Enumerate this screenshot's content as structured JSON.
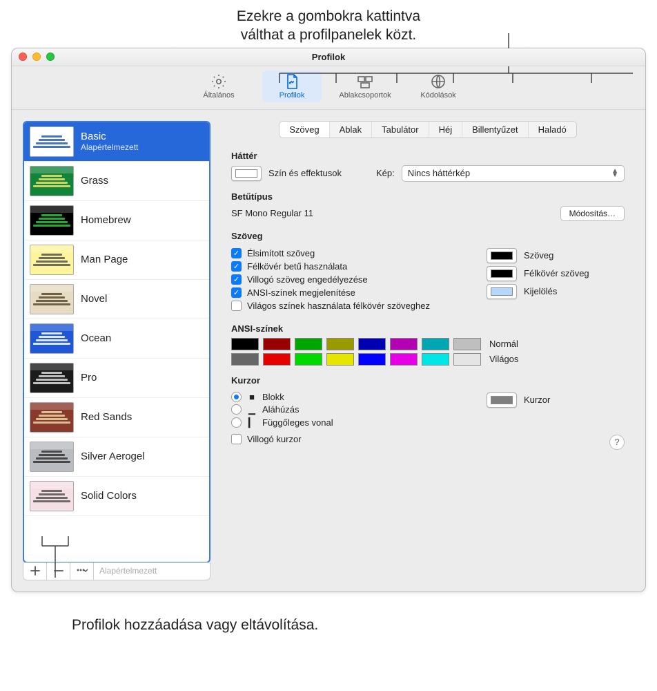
{
  "callouts": {
    "top_line1": "Ezekre a gombokra kattintva",
    "top_line2": "válthat a profilpanelek közt.",
    "bottom": "Profilok hozzáadása vagy eltávolítása."
  },
  "window": {
    "title": "Profilok"
  },
  "toolbar": {
    "items": [
      {
        "label": "Általános"
      },
      {
        "label": "Profilok"
      },
      {
        "label": "Ablakcsoportok"
      },
      {
        "label": "Kódolások"
      }
    ]
  },
  "sidebar": {
    "profiles": [
      {
        "name": "Basic",
        "subtitle": "Alapértelmezett",
        "bg": "#ffffff",
        "fg": "#2a5db0"
      },
      {
        "name": "Grass",
        "subtitle": "",
        "bg": "#12853a",
        "fg": "#f0e26a"
      },
      {
        "name": "Homebrew",
        "subtitle": "",
        "bg": "#000000",
        "fg": "#27c93f"
      },
      {
        "name": "Man Page",
        "subtitle": "",
        "bg": "#fdf49b",
        "fg": "#555555"
      },
      {
        "name": "Novel",
        "subtitle": "",
        "bg": "#e6dcc3",
        "fg": "#5a4b2f"
      },
      {
        "name": "Ocean",
        "subtitle": "",
        "bg": "#1f57d6",
        "fg": "#ffffff"
      },
      {
        "name": "Pro",
        "subtitle": "",
        "bg": "#1b1b1b",
        "fg": "#dddddd"
      },
      {
        "name": "Red Sands",
        "subtitle": "",
        "bg": "#8a3a2d",
        "fg": "#e8d7a6"
      },
      {
        "name": "Silver Aerogel",
        "subtitle": "",
        "bg": "#b9bcc0",
        "fg": "#333333"
      },
      {
        "name": "Solid Colors",
        "subtitle": "",
        "bg": "#f6dfe4",
        "fg": "#555555"
      }
    ],
    "footer_default": "Alapértelmezett"
  },
  "tabs": [
    "Szöveg",
    "Ablak",
    "Tabulátor",
    "Héj",
    "Billentyűzet",
    "Haladó"
  ],
  "panel": {
    "background": {
      "title": "Háttér",
      "swatch_label": "Szín és effektusok",
      "image_label": "Kép:",
      "image_select": "Nincs háttérkép"
    },
    "font": {
      "title": "Betűtípus",
      "value": "SF Mono Regular 11",
      "change_btn": "Módosítás…"
    },
    "text": {
      "title": "Szöveg",
      "checks": [
        {
          "label": "Élsimított szöveg",
          "on": true
        },
        {
          "label": "Félkövér betű használata",
          "on": true
        },
        {
          "label": "Villogó szöveg engedélyezése",
          "on": true
        },
        {
          "label": "ANSI-színek megjelenítése",
          "on": true
        },
        {
          "label": "Világos színek használata félkövér szöveghez",
          "on": false
        }
      ],
      "swatches": [
        {
          "label": "Szöveg",
          "color": "#000000"
        },
        {
          "label": "Félkövér szöveg",
          "color": "#000000"
        },
        {
          "label": "Kijelölés",
          "color": "#b3d7ff"
        }
      ]
    },
    "ansi": {
      "title": "ANSI-színek",
      "normal_label": "Normál",
      "bright_label": "Világos",
      "normal": [
        "#000000",
        "#990000",
        "#00a600",
        "#999900",
        "#0000b2",
        "#b200b2",
        "#00a6b2",
        "#bfbfbf"
      ],
      "bright": [
        "#666666",
        "#e50000",
        "#00d900",
        "#e5e500",
        "#0000ff",
        "#e500e5",
        "#00e5e5",
        "#e5e5e5"
      ]
    },
    "cursor": {
      "title": "Kurzor",
      "options": [
        {
          "label": "Blokk",
          "glyph": "■"
        },
        {
          "label": "Aláhúzás",
          "glyph": "▁"
        },
        {
          "label": "Függőleges vonal",
          "glyph": "▎"
        }
      ],
      "blink_label": "Villogó kurzor",
      "swatch_label": "Kurzor",
      "swatch_color": "#7f7f7f"
    }
  }
}
